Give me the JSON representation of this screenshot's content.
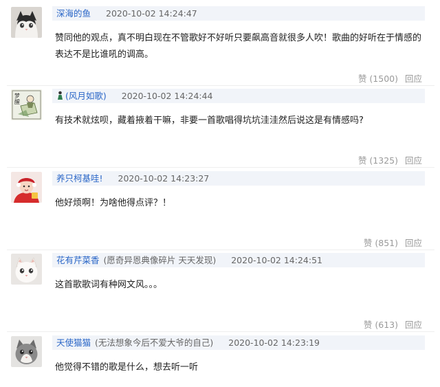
{
  "comments": [
    {
      "username": "深海的鱼",
      "subtitle": "",
      "time": "2020-10-02 14:24:47",
      "content": "赞同他的观点，真不明白现在不管歌好不好听只要飙高音就很多人吹！歌曲的好听在于情感的表达不是比谁吼的调高。",
      "like": "赞 (1500)",
      "reply": "回应",
      "avatar_icon": "cat-avatar-icon"
    },
    {
      "username": "(风月如歌)",
      "subtitle": "",
      "time": "2020-10-02 14:24:44",
      "content": "有技术就炫呗，藏着掖着干嘛，非要一首歌唱得坑坑洼洼然后说这是有情感吗?",
      "like": "赞 (1325)",
      "reply": "回应",
      "avatar_icon": "cartoon-book-avatar-icon",
      "badge_icon": "figure-badge-icon"
    },
    {
      "username": "养只柯基哇!",
      "subtitle": "",
      "time": "2020-10-02 14:23:27",
      "content": "他好烦啊！为啥他得点评？！",
      "like": "赞 (851)",
      "reply": "回应",
      "avatar_icon": "child-red-hat-avatar-icon"
    },
    {
      "username": "花有芹菜香",
      "subtitle": "(愿奇异恩典像碎片 天天发现)",
      "time": "2020-10-02 14:24:51",
      "content": "这首歌歌词有种网文风。。。",
      "like": "赞 (613)",
      "reply": "回应",
      "avatar_icon": "white-kitten-avatar-icon"
    },
    {
      "username": "天使猫猫",
      "subtitle": "(无法想象今后不爱大爷的自己)",
      "time": "2020-10-02 14:23:19",
      "content": "他觉得不错的歌是什么，想去听一听",
      "like": "",
      "reply": "",
      "avatar_icon": "grey-kitten-avatar-icon"
    }
  ],
  "colors": {
    "username": "#2a66c7",
    "meta_bar": "#f1f4f9",
    "muted": "#999999"
  }
}
